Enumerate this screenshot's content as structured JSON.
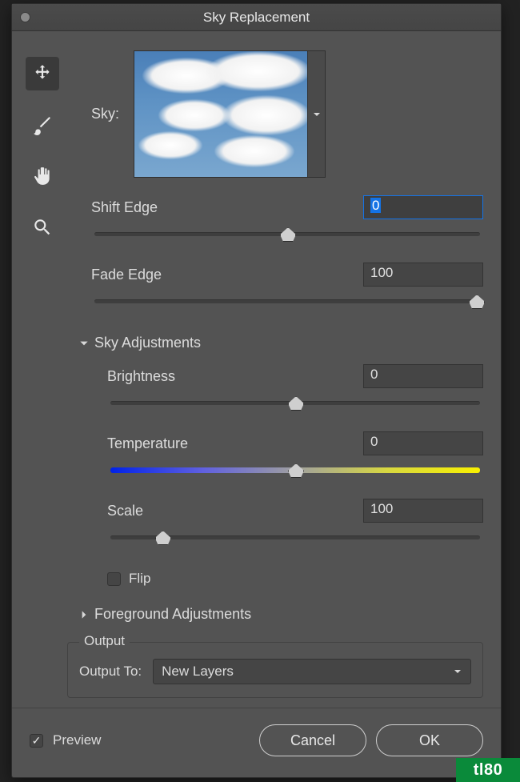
{
  "dialog": {
    "title": "Sky Replacement"
  },
  "tools": {
    "move": "move-tool",
    "brush": "brush-tool",
    "hand": "hand-tool",
    "zoom": "zoom-tool"
  },
  "sky": {
    "label": "Sky:"
  },
  "controls": {
    "shift_edge": {
      "label": "Shift Edge",
      "value": "0",
      "pos": 50
    },
    "fade_edge": {
      "label": "Fade Edge",
      "value": "100",
      "pos": 100
    }
  },
  "sky_adjustments": {
    "title": "Sky Adjustments",
    "brightness": {
      "label": "Brightness",
      "value": "0",
      "pos": 50
    },
    "temperature": {
      "label": "Temperature",
      "value": "0",
      "pos": 50
    },
    "scale": {
      "label": "Scale",
      "value": "100",
      "pos": 14
    },
    "flip": {
      "label": "Flip",
      "checked": false
    }
  },
  "foreground": {
    "title": "Foreground Adjustments"
  },
  "output": {
    "legend": "Output",
    "label": "Output To:",
    "value": "New Layers"
  },
  "footer": {
    "preview_label": "Preview",
    "preview_checked": true,
    "cancel": "Cancel",
    "ok": "OK"
  },
  "watermark": "tl80"
}
